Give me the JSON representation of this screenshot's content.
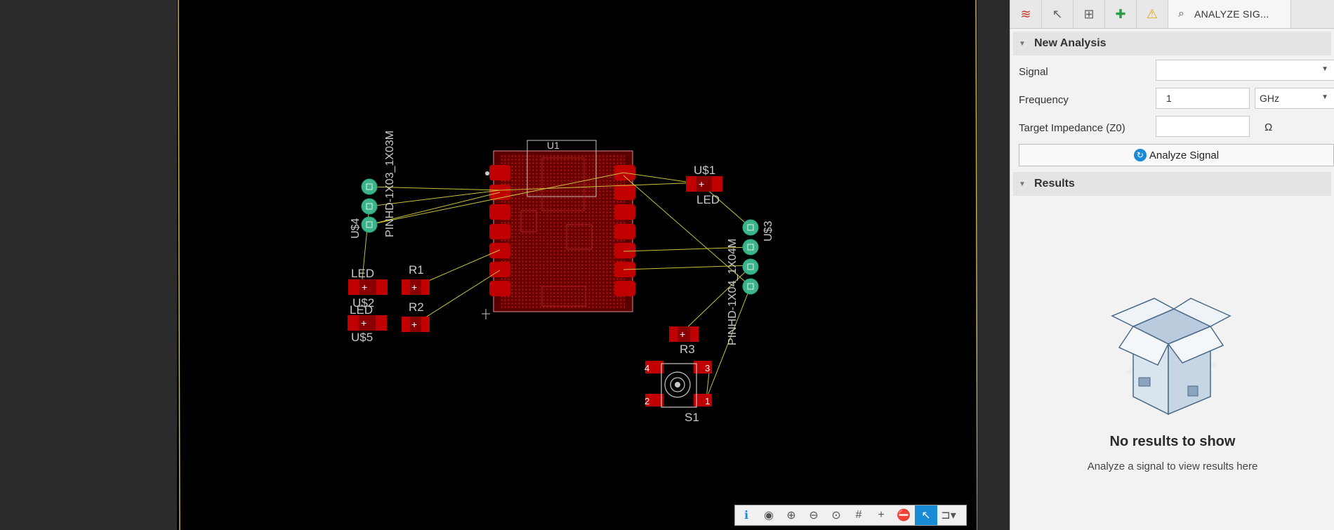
{
  "board": {
    "components": {
      "u1": "U1",
      "u4": "U$4",
      "pinhd_3": "PINHD-1X03_1X03M",
      "r1": "R1",
      "r2": "R2",
      "r3": "R3",
      "led_a": "LED",
      "led_b": "LED",
      "led_c": "LED",
      "u2": "U$2",
      "u5": "U$5",
      "u1_led": "U$1",
      "u3": "U$3",
      "pinhd_4": "PINHD-1X04_1X04M",
      "s1": "S1",
      "s1_pin_4": "4",
      "s1_pin_3": "3",
      "s1_pin_2": "2",
      "s1_pin_1": "1"
    },
    "colors": {
      "copper": "#c00000",
      "via": "#3db38a",
      "airwire": "#c9c23a",
      "silk": "#c8c8c8",
      "border": "#c8b44a"
    }
  },
  "toolbar": {
    "items": [
      {
        "name": "info-icon",
        "glyph": "ℹ"
      },
      {
        "name": "eye-icon",
        "glyph": "◉"
      },
      {
        "name": "zoom-in-icon",
        "glyph": "⊕"
      },
      {
        "name": "zoom-out-icon",
        "glyph": "⊖"
      },
      {
        "name": "zoom-fit-icon",
        "glyph": "⊙"
      },
      {
        "name": "grid-icon",
        "glyph": "#"
      },
      {
        "name": "crosshair-icon",
        "glyph": "+"
      },
      {
        "name": "stop-icon",
        "glyph": "⛔"
      },
      {
        "name": "select-pointer-icon",
        "glyph": "↖"
      },
      {
        "name": "route-dropdown-icon",
        "glyph": "⊐▾"
      }
    ]
  },
  "panel": {
    "tabs": [
      {
        "name": "layers-tab",
        "glyph": "≋"
      },
      {
        "name": "select-tab",
        "glyph": "↖"
      },
      {
        "name": "tree-tab",
        "glyph": "⊞"
      },
      {
        "name": "add-part-tab",
        "glyph": "✚"
      },
      {
        "name": "warning-tab",
        "glyph": "⚠"
      }
    ],
    "active_tab_label": "ANALYZE SIG...",
    "new_analysis": {
      "title": "New Analysis",
      "signal_label": "Signal",
      "signal_value": "",
      "frequency_label": "Frequency",
      "frequency_value": "1",
      "frequency_unit": "GHz",
      "impedance_label": "Target Impedance (Z0)",
      "impedance_value": "",
      "impedance_unit": "Ω",
      "analyze_button": "Analyze Signal"
    },
    "results": {
      "title": "Results",
      "empty_title": "No results to show",
      "empty_subtitle": "Analyze a signal to view results here"
    }
  }
}
